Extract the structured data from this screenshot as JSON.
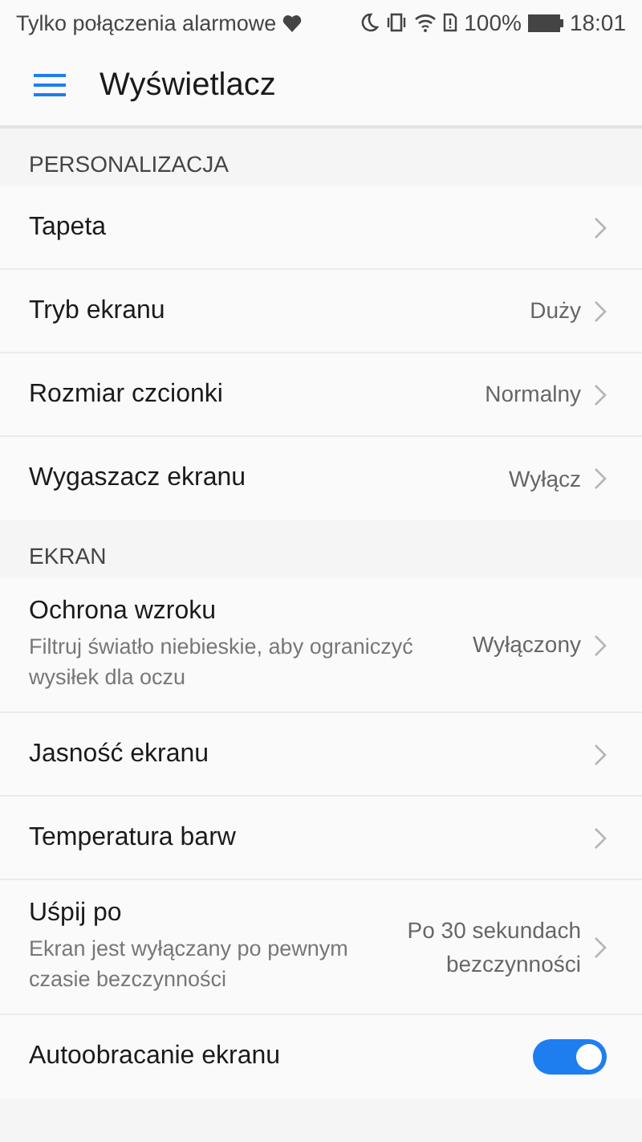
{
  "status_bar": {
    "notice": "Tylko połączenia alarmowe",
    "battery_text": "100%",
    "time": "18:01"
  },
  "header": {
    "title": "Wyświetlacz"
  },
  "sections": [
    {
      "title": "PERSONALIZACJA",
      "items": [
        {
          "kind": "link",
          "label": "Tapeta"
        },
        {
          "kind": "link",
          "label": "Tryb ekranu",
          "value": "Duży"
        },
        {
          "kind": "link",
          "label": "Rozmiar czcionki",
          "value": "Normalny"
        },
        {
          "kind": "link",
          "label": "Wygaszacz ekranu",
          "value": "Wyłącz"
        }
      ]
    },
    {
      "title": "EKRAN",
      "items": [
        {
          "kind": "link",
          "label": "Ochrona wzroku",
          "subtitle": "Filtruj światło niebieskie, aby ograniczyć wysiłek dla oczu",
          "value": "Wyłączony"
        },
        {
          "kind": "link",
          "label": "Jasność ekranu"
        },
        {
          "kind": "link",
          "label": "Temperatura barw"
        },
        {
          "kind": "link",
          "label": "Uśpij po",
          "subtitle": "Ekran jest wyłączany po pewnym czasie bezczynności",
          "value": "Po 30 sekundach bezczynności"
        },
        {
          "kind": "toggle",
          "label": "Autoobracanie ekranu",
          "on": true
        }
      ]
    }
  ]
}
